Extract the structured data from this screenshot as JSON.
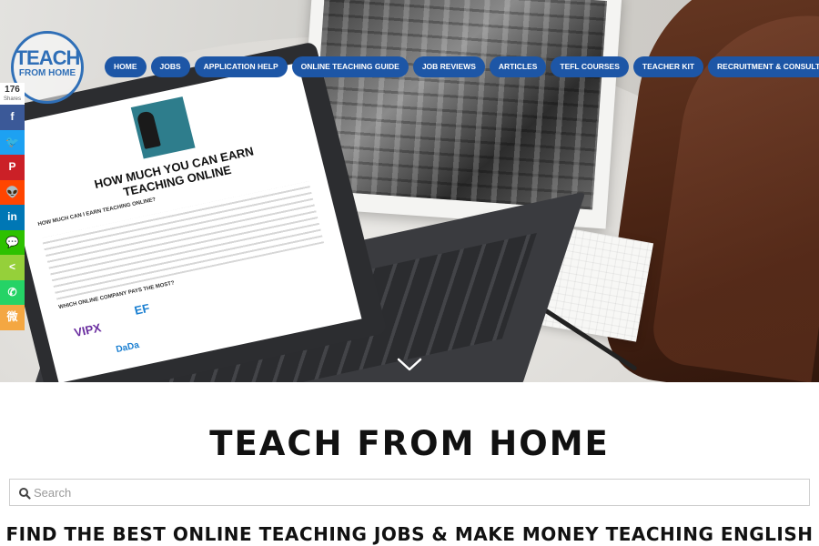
{
  "logo": {
    "line1": "TEACH",
    "line2": "FROM HOME"
  },
  "nav": {
    "items": [
      {
        "label": "HOME"
      },
      {
        "label": "JOBS"
      },
      {
        "label": "APPLICATION HELP"
      },
      {
        "label": "ONLINE TEACHING GUIDE"
      },
      {
        "label": "JOB REVIEWS"
      },
      {
        "label": "ARTICLES"
      },
      {
        "label": "TEFL COURSES"
      },
      {
        "label": "TEACHER KIT"
      },
      {
        "label": "RECRUITMENT & CONSULTING"
      }
    ],
    "color": "#1d56a6"
  },
  "share": {
    "count": "176",
    "count_label": "Shares",
    "buttons": [
      {
        "icon": "facebook-icon",
        "glyph": "f",
        "color": "#3b5998"
      },
      {
        "icon": "twitter-icon",
        "glyph": "🐦",
        "color": "#1da1f2"
      },
      {
        "icon": "pinterest-icon",
        "glyph": "P",
        "color": "#cb2027"
      },
      {
        "icon": "reddit-icon",
        "glyph": "👽",
        "color": "#ff4500"
      },
      {
        "icon": "linkedin-icon",
        "glyph": "in",
        "color": "#0077b5"
      },
      {
        "icon": "wechat-icon",
        "glyph": "💬",
        "color": "#2dc100"
      },
      {
        "icon": "share-icon",
        "glyph": "<",
        "color": "#95d03a"
      },
      {
        "icon": "whatsapp-icon",
        "glyph": "✆",
        "color": "#25d366"
      },
      {
        "icon": "weibo-icon",
        "glyph": "微",
        "color": "#f4a742"
      }
    ]
  },
  "hero": {
    "screen_headline": "HOW MUCH YOU CAN EARN TEACHING ONLINE",
    "screen_sub1": "HOW MUCH CAN I EARN TEACHING ONLINE?",
    "screen_sub2": "WHICH ONLINE COMPANY PAYS THE MOST?",
    "screen_logos": [
      "VIPX",
      "EF",
      "DaDa"
    ]
  },
  "main": {
    "title": "TEACH FROM HOME",
    "search_placeholder": "Search",
    "tagline": "FIND THE BEST ONLINE TEACHING JOBS & MAKE MONEY TEACHING ENGLISH"
  }
}
